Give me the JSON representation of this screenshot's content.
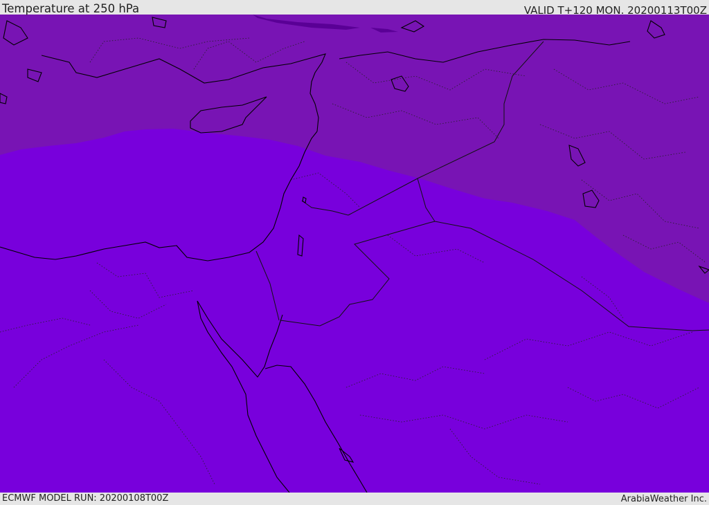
{
  "header": {
    "title": "Temperature at 250 hPa",
    "valid": "VALID T+120 MON. 20200113T00Z"
  },
  "footer": {
    "model_run": "ECMWF MODEL RUN: 20200108T00Z",
    "credit": "ArabiaWeather Inc."
  },
  "colors": {
    "cold_band": "#7814b4",
    "main_field": "#7800dc",
    "coldest_patch": "#5a0096",
    "coastline": "#000000",
    "border": "#111111"
  }
}
